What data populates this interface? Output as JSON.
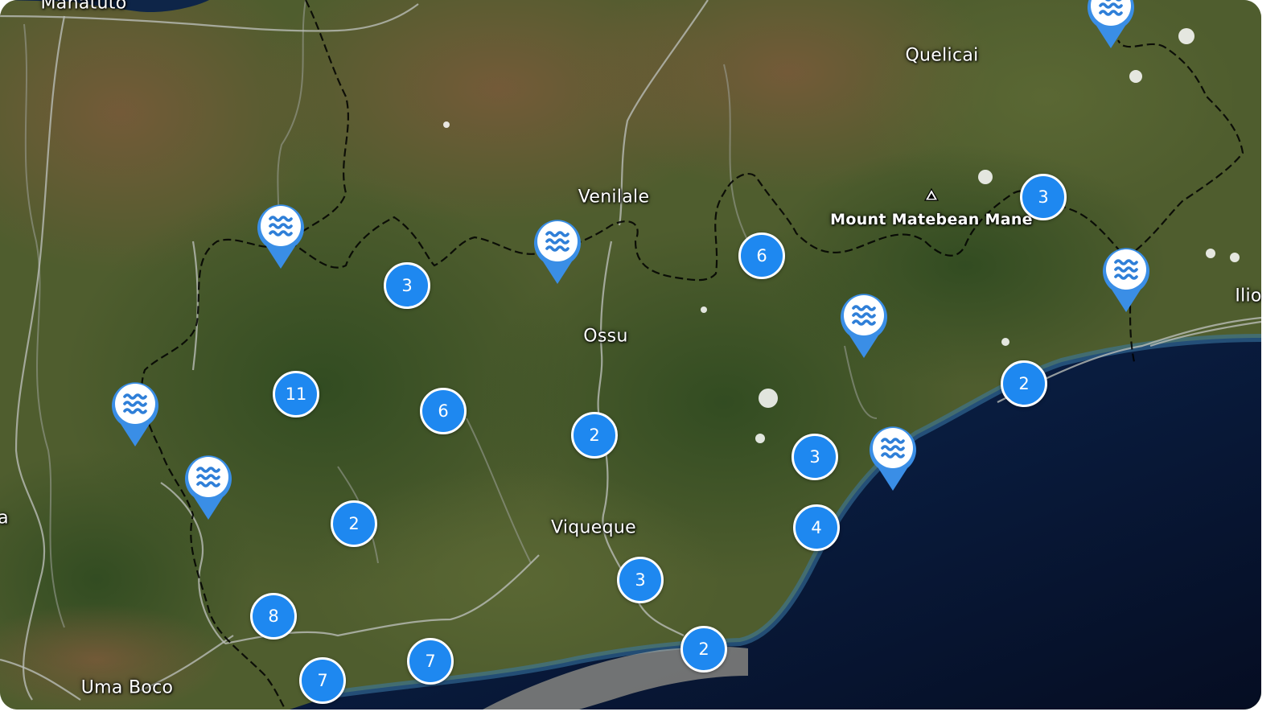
{
  "map": {
    "type": "satellite",
    "colors": {
      "cluster_fill": "#1e88f0",
      "cluster_border": "#ffffff",
      "pin_fill": "#3a8ee6",
      "pin_icon": "#2f7fd8",
      "sea": "#0a1b3a",
      "land": "#4c5a2c"
    },
    "labels": [
      {
        "id": "manatuto",
        "text": "Manatuto"
      },
      {
        "id": "quelicai",
        "text": "Quelicai"
      },
      {
        "id": "venilale",
        "text": "Venilale"
      },
      {
        "id": "mount-matebean",
        "text": "Mount Matebean Mane"
      },
      {
        "id": "ossu",
        "text": "Ossu"
      },
      {
        "id": "ilio",
        "text": "Ilio"
      },
      {
        "id": "viqueque",
        "text": "Viqueque"
      },
      {
        "id": "uma-boco",
        "text": "Uma Boco"
      },
      {
        "id": "edge-a",
        "text": "a"
      }
    ],
    "clusters": [
      {
        "count": "3"
      },
      {
        "count": "6"
      },
      {
        "count": "3"
      },
      {
        "count": "11"
      },
      {
        "count": "6"
      },
      {
        "count": "2"
      },
      {
        "count": "2"
      },
      {
        "count": "3"
      },
      {
        "count": "4"
      },
      {
        "count": "2"
      },
      {
        "count": "3"
      },
      {
        "count": "8"
      },
      {
        "count": "7"
      },
      {
        "count": "7"
      },
      {
        "count": "2"
      }
    ],
    "pins": [
      {
        "icon": "water-wave-icon"
      },
      {
        "icon": "water-wave-icon"
      },
      {
        "icon": "water-wave-icon"
      },
      {
        "icon": "water-wave-icon"
      },
      {
        "icon": "water-wave-icon"
      },
      {
        "icon": "water-wave-icon"
      },
      {
        "icon": "water-wave-icon"
      },
      {
        "icon": "water-wave-icon"
      }
    ]
  }
}
